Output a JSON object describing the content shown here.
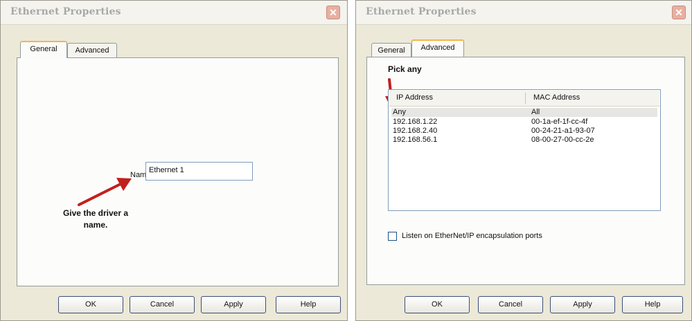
{
  "left_dialog": {
    "title": "Ethernet Properties",
    "close_glyph": "✕",
    "tabs": [
      {
        "label": "General",
        "active": true
      },
      {
        "label": "Advanced",
        "active": false
      }
    ],
    "name_label": "Name",
    "name_value": "Ethernet 1",
    "annotation": "Give the driver a name.",
    "buttons": {
      "ok": "OK",
      "cancel": "Cancel",
      "apply": "Apply",
      "help": "Help"
    }
  },
  "right_dialog": {
    "title": "Ethernet Properties",
    "close_glyph": "✕",
    "tabs": [
      {
        "label": "General",
        "active": false
      },
      {
        "label": "Advanced",
        "active": true
      }
    ],
    "annotation": "Pick any",
    "list": {
      "columns": [
        "IP Address",
        "MAC Address"
      ],
      "rows": [
        {
          "ip": "Any",
          "mac": "All",
          "selected": true
        },
        {
          "ip": "192.168.1.22",
          "mac": "00-1a-ef-1f-cc-4f",
          "selected": false
        },
        {
          "ip": "192.168.2.40",
          "mac": "00-24-21-a1-93-07",
          "selected": false
        },
        {
          "ip": "192.168.56.1",
          "mac": "08-00-27-00-cc-2e",
          "selected": false
        }
      ]
    },
    "checkbox_label": "Listen on EtherNet/IP encapsulation ports",
    "checkbox_checked": false,
    "buttons": {
      "ok": "OK",
      "cancel": "Cancel",
      "apply": "Apply",
      "help": "Help"
    }
  },
  "colors": {
    "dialog_bg": "#ece9d8",
    "arrow": "#c0201c",
    "close_button": "#e7b0a0",
    "tab_highlight": "#f1b74a"
  },
  "icons": {
    "close": "close-icon",
    "annotation_arrow": "arrow-annotation-icon"
  }
}
